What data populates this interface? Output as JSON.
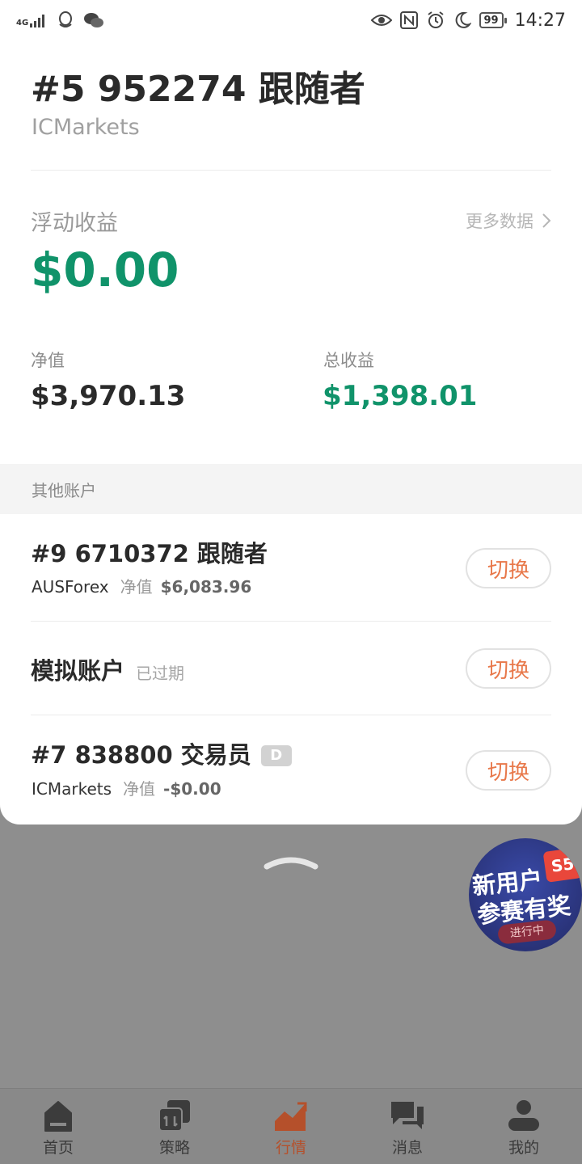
{
  "status_bar": {
    "network": "4G",
    "battery": "99",
    "time": "14:27"
  },
  "account": {
    "title": "#5 952274 跟随者",
    "broker": "ICMarkets"
  },
  "floating": {
    "label": "浮动收益",
    "more_label": "更多数据",
    "value": "$0.00"
  },
  "stats": {
    "net_label": "净值",
    "net_value": "$3,970.13",
    "total_label": "总收益",
    "total_value": "$1,398.01"
  },
  "other_accounts": {
    "header": "其他账户",
    "items": [
      {
        "title": "#9 6710372 跟随者",
        "broker": "AUSForex",
        "net_label": "净值",
        "net_value": "$6,083.96",
        "button": "切换"
      },
      {
        "title": "模拟账户",
        "status": "已过期",
        "button": "切换"
      },
      {
        "title": "#7 838800 交易员",
        "badge": "D",
        "broker": "ICMarkets",
        "net_label": "净值",
        "net_value": "-$0.00",
        "button": "切换"
      }
    ]
  },
  "promo": {
    "line1": "新用户",
    "line2": "参赛有奖",
    "badge": "S5",
    "status": "进行中"
  },
  "nav": {
    "items": [
      {
        "label": "首页",
        "icon": "home-icon"
      },
      {
        "label": "策略",
        "icon": "strategy-icon"
      },
      {
        "label": "行情",
        "icon": "market-chart-icon",
        "active": true
      },
      {
        "label": "消息",
        "icon": "message-icon"
      },
      {
        "label": "我的",
        "icon": "profile-icon"
      }
    ]
  },
  "colors": {
    "profit_green": "#10936a",
    "accent_orange": "#e8784a",
    "nav_active": "#b5502b"
  }
}
